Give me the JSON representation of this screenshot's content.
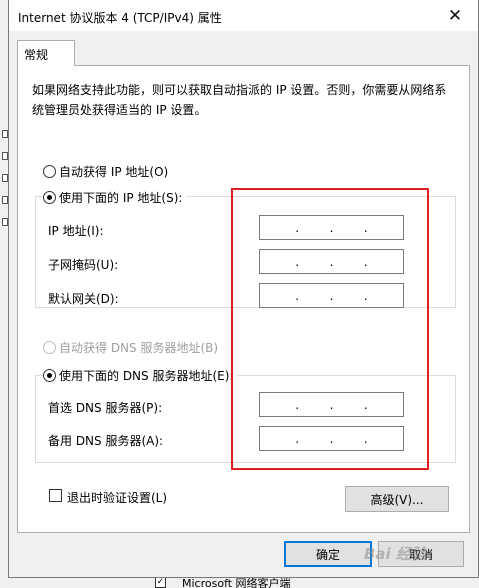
{
  "dialog": {
    "title": "Internet 协议版本 4 (TCP/IPv4) 属性",
    "close_glyph": "✕",
    "tab_label": "常规",
    "description": "如果网络支持此功能，则可以获取自动指派的 IP 设置。否则，你需要从网络系统管理员处获得适当的 IP 设置。",
    "ip_section": {
      "auto_label": "自动获得 IP 地址(O)",
      "manual_label": "使用下面的 IP 地址(S):",
      "selected": "manual",
      "fields": [
        {
          "label": "IP 地址(I):",
          "value": ""
        },
        {
          "label": "子网掩码(U):",
          "value": ""
        },
        {
          "label": "默认网关(D):",
          "value": ""
        }
      ]
    },
    "dns_section": {
      "auto_label": "自动获得 DNS 服务器地址(B)",
      "manual_label": "使用下面的 DNS 服务器地址(E):",
      "selected": "manual",
      "fields": [
        {
          "label": "首选 DNS 服务器(P):",
          "value": ""
        },
        {
          "label": "备用 DNS 服务器(A):",
          "value": ""
        }
      ]
    },
    "validate_checkbox_label": "退出时验证设置(L)",
    "validate_checked": false,
    "advanced_button": "高级(V)...",
    "ok_button": "确定",
    "cancel_button": "取消"
  },
  "background": {
    "bottom_item_label": "Microsoft 网络客户端",
    "bottom_item_checked": true,
    "bottom_check_glyph": "✓"
  },
  "watermark": "Bai 经验",
  "ip_dot_glyph": ".",
  "colors": {
    "highlight_box": "#e02020",
    "default_button_border": "#0078d7"
  }
}
